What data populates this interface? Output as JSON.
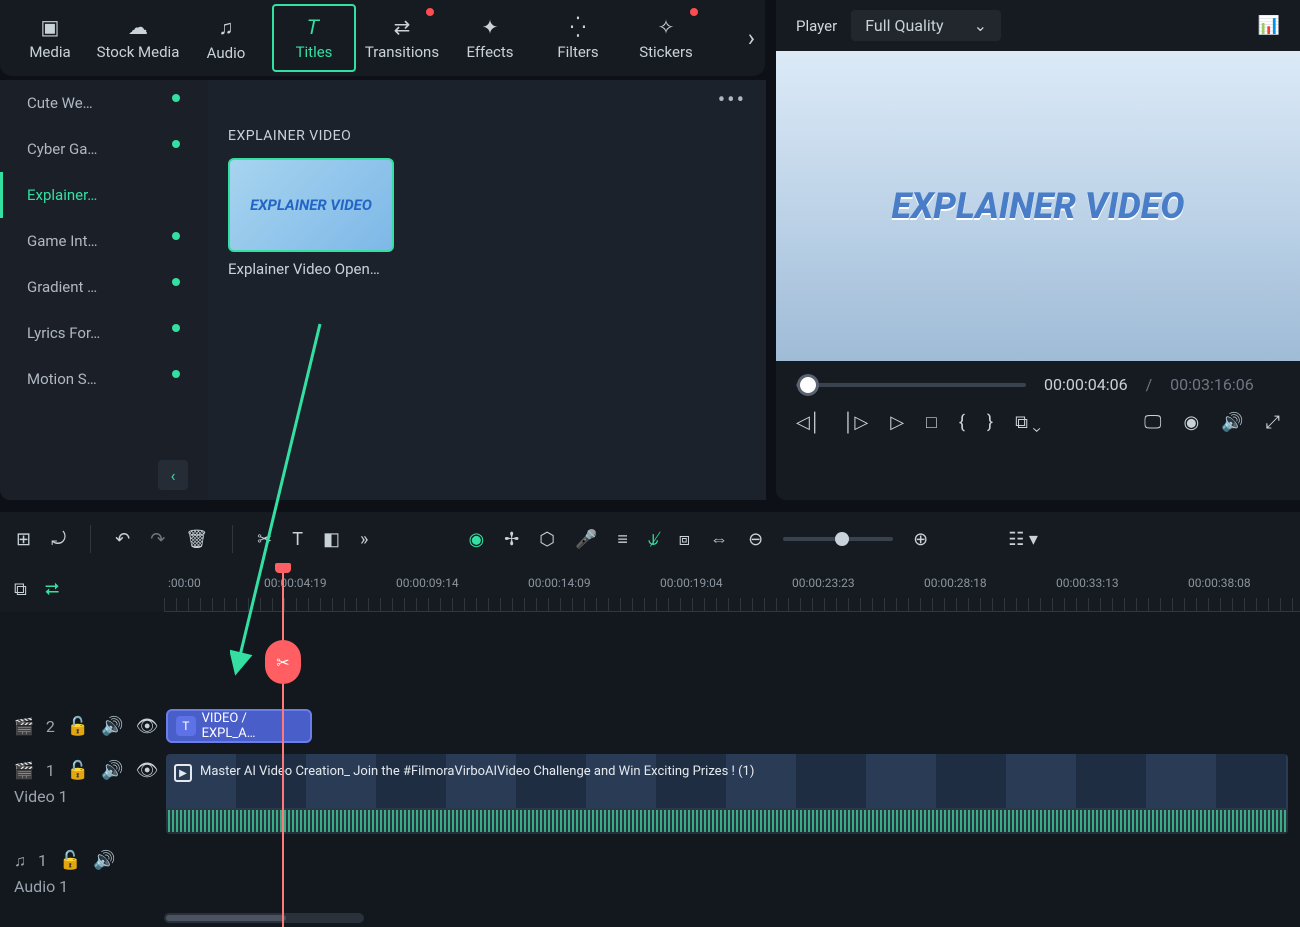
{
  "topTabs": {
    "media": "Media",
    "stockMedia": "Stock Media",
    "audio": "Audio",
    "titles": "Titles",
    "transitions": "Transitions",
    "effects": "Effects",
    "filters": "Filters",
    "stickers": "Stickers"
  },
  "sidebar": {
    "items": [
      "Cute We…",
      "Cyber Ga…",
      "Explainer…",
      "Game Int…",
      "Gradient …",
      "Lyrics For…",
      "Motion S…"
    ],
    "activeIndex": 2
  },
  "assets": {
    "sectionTitle": "EXPLAINER VIDEO",
    "item": {
      "thumbText": "EXPLAINER VIDEO",
      "label": "Explainer Video Open…"
    }
  },
  "player": {
    "label": "Player",
    "quality": "Full Quality",
    "previewTitle": "EXPLAINER VIDEO",
    "currentTime": "00:00:04:06",
    "separator": "/",
    "totalTime": "00:03:16:06"
  },
  "ruler": {
    "ticks": [
      ":00:00",
      "00:00:04:19",
      "00:00:09:14",
      "00:00:14:09",
      "00:00:19:04",
      "00:00:23:23",
      "00:00:28:18",
      "00:00:33:13",
      "00:00:38:08"
    ]
  },
  "tracks": {
    "titleClip": "VIDEO / EXPL_A…",
    "videoClip": "Master AI Video Creation_ Join the #FilmoraVirboAIVideo Challenge and Win Exciting Prizes ! (1)",
    "trackTitleIndex": "2",
    "video1Index": "1",
    "video1Label": "Video 1",
    "audio1Index": "1",
    "audio1Label": "Audio 1"
  }
}
